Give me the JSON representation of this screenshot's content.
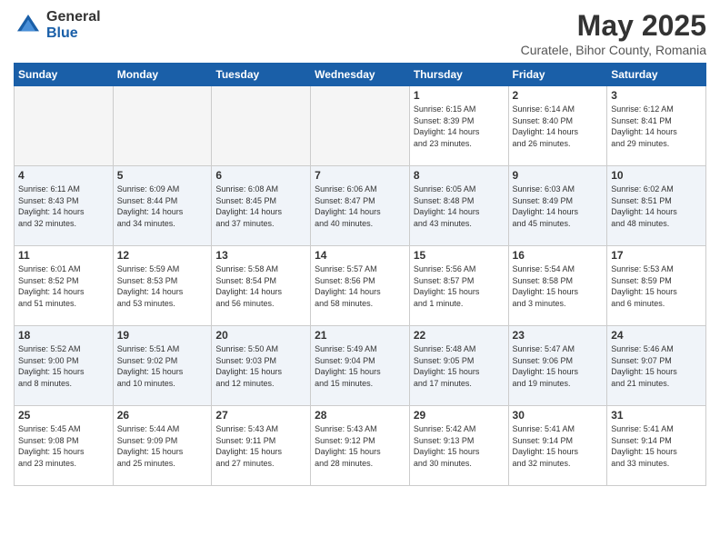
{
  "logo": {
    "general": "General",
    "blue": "Blue"
  },
  "title": "May 2025",
  "subtitle": "Curatele, Bihor County, Romania",
  "days_header": [
    "Sunday",
    "Monday",
    "Tuesday",
    "Wednesday",
    "Thursday",
    "Friday",
    "Saturday"
  ],
  "weeks": [
    [
      {
        "num": "",
        "info": "",
        "empty": true
      },
      {
        "num": "",
        "info": "",
        "empty": true
      },
      {
        "num": "",
        "info": "",
        "empty": true
      },
      {
        "num": "",
        "info": "",
        "empty": true
      },
      {
        "num": "1",
        "info": "Sunrise: 6:15 AM\nSunset: 8:39 PM\nDaylight: 14 hours\nand 23 minutes.",
        "empty": false
      },
      {
        "num": "2",
        "info": "Sunrise: 6:14 AM\nSunset: 8:40 PM\nDaylight: 14 hours\nand 26 minutes.",
        "empty": false
      },
      {
        "num": "3",
        "info": "Sunrise: 6:12 AM\nSunset: 8:41 PM\nDaylight: 14 hours\nand 29 minutes.",
        "empty": false
      }
    ],
    [
      {
        "num": "4",
        "info": "Sunrise: 6:11 AM\nSunset: 8:43 PM\nDaylight: 14 hours\nand 32 minutes.",
        "empty": false
      },
      {
        "num": "5",
        "info": "Sunrise: 6:09 AM\nSunset: 8:44 PM\nDaylight: 14 hours\nand 34 minutes.",
        "empty": false
      },
      {
        "num": "6",
        "info": "Sunrise: 6:08 AM\nSunset: 8:45 PM\nDaylight: 14 hours\nand 37 minutes.",
        "empty": false
      },
      {
        "num": "7",
        "info": "Sunrise: 6:06 AM\nSunset: 8:47 PM\nDaylight: 14 hours\nand 40 minutes.",
        "empty": false
      },
      {
        "num": "8",
        "info": "Sunrise: 6:05 AM\nSunset: 8:48 PM\nDaylight: 14 hours\nand 43 minutes.",
        "empty": false
      },
      {
        "num": "9",
        "info": "Sunrise: 6:03 AM\nSunset: 8:49 PM\nDaylight: 14 hours\nand 45 minutes.",
        "empty": false
      },
      {
        "num": "10",
        "info": "Sunrise: 6:02 AM\nSunset: 8:51 PM\nDaylight: 14 hours\nand 48 minutes.",
        "empty": false
      }
    ],
    [
      {
        "num": "11",
        "info": "Sunrise: 6:01 AM\nSunset: 8:52 PM\nDaylight: 14 hours\nand 51 minutes.",
        "empty": false
      },
      {
        "num": "12",
        "info": "Sunrise: 5:59 AM\nSunset: 8:53 PM\nDaylight: 14 hours\nand 53 minutes.",
        "empty": false
      },
      {
        "num": "13",
        "info": "Sunrise: 5:58 AM\nSunset: 8:54 PM\nDaylight: 14 hours\nand 56 minutes.",
        "empty": false
      },
      {
        "num": "14",
        "info": "Sunrise: 5:57 AM\nSunset: 8:56 PM\nDaylight: 14 hours\nand 58 minutes.",
        "empty": false
      },
      {
        "num": "15",
        "info": "Sunrise: 5:56 AM\nSunset: 8:57 PM\nDaylight: 15 hours\nand 1 minute.",
        "empty": false
      },
      {
        "num": "16",
        "info": "Sunrise: 5:54 AM\nSunset: 8:58 PM\nDaylight: 15 hours\nand 3 minutes.",
        "empty": false
      },
      {
        "num": "17",
        "info": "Sunrise: 5:53 AM\nSunset: 8:59 PM\nDaylight: 15 hours\nand 6 minutes.",
        "empty": false
      }
    ],
    [
      {
        "num": "18",
        "info": "Sunrise: 5:52 AM\nSunset: 9:00 PM\nDaylight: 15 hours\nand 8 minutes.",
        "empty": false
      },
      {
        "num": "19",
        "info": "Sunrise: 5:51 AM\nSunset: 9:02 PM\nDaylight: 15 hours\nand 10 minutes.",
        "empty": false
      },
      {
        "num": "20",
        "info": "Sunrise: 5:50 AM\nSunset: 9:03 PM\nDaylight: 15 hours\nand 12 minutes.",
        "empty": false
      },
      {
        "num": "21",
        "info": "Sunrise: 5:49 AM\nSunset: 9:04 PM\nDaylight: 15 hours\nand 15 minutes.",
        "empty": false
      },
      {
        "num": "22",
        "info": "Sunrise: 5:48 AM\nSunset: 9:05 PM\nDaylight: 15 hours\nand 17 minutes.",
        "empty": false
      },
      {
        "num": "23",
        "info": "Sunrise: 5:47 AM\nSunset: 9:06 PM\nDaylight: 15 hours\nand 19 minutes.",
        "empty": false
      },
      {
        "num": "24",
        "info": "Sunrise: 5:46 AM\nSunset: 9:07 PM\nDaylight: 15 hours\nand 21 minutes.",
        "empty": false
      }
    ],
    [
      {
        "num": "25",
        "info": "Sunrise: 5:45 AM\nSunset: 9:08 PM\nDaylight: 15 hours\nand 23 minutes.",
        "empty": false
      },
      {
        "num": "26",
        "info": "Sunrise: 5:44 AM\nSunset: 9:09 PM\nDaylight: 15 hours\nand 25 minutes.",
        "empty": false
      },
      {
        "num": "27",
        "info": "Sunrise: 5:43 AM\nSunset: 9:11 PM\nDaylight: 15 hours\nand 27 minutes.",
        "empty": false
      },
      {
        "num": "28",
        "info": "Sunrise: 5:43 AM\nSunset: 9:12 PM\nDaylight: 15 hours\nand 28 minutes.",
        "empty": false
      },
      {
        "num": "29",
        "info": "Sunrise: 5:42 AM\nSunset: 9:13 PM\nDaylight: 15 hours\nand 30 minutes.",
        "empty": false
      },
      {
        "num": "30",
        "info": "Sunrise: 5:41 AM\nSunset: 9:14 PM\nDaylight: 15 hours\nand 32 minutes.",
        "empty": false
      },
      {
        "num": "31",
        "info": "Sunrise: 5:41 AM\nSunset: 9:14 PM\nDaylight: 15 hours\nand 33 minutes.",
        "empty": false
      }
    ]
  ]
}
